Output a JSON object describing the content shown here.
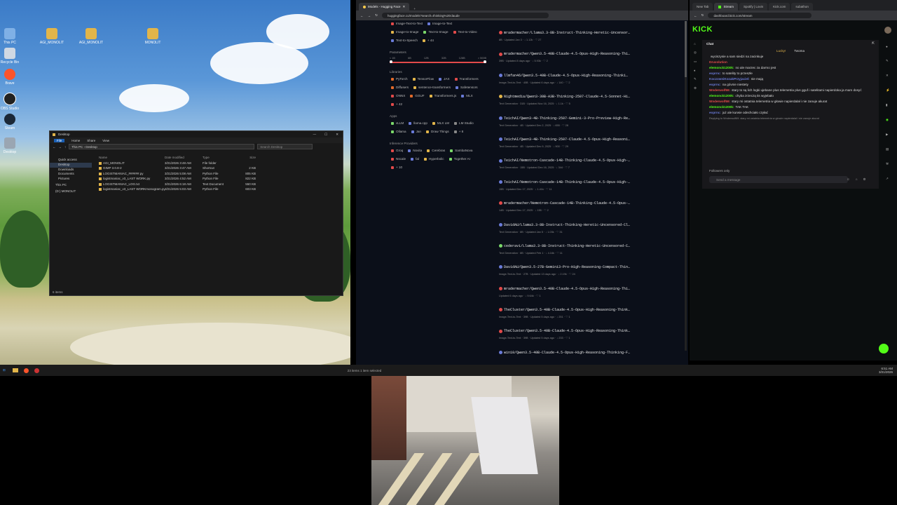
{
  "desktop": {
    "icons": [
      {
        "label": "This PC"
      },
      {
        "label": "AGI_MONOLIT"
      },
      {
        "label": "AGI_MONOLIT"
      },
      {
        "label": "MONOLIT"
      },
      {
        "label": "Recycle Bin"
      },
      {
        "label": "Brave"
      },
      {
        "label": "OBS Studio"
      },
      {
        "label": "Steam"
      },
      {
        "label": "Desktop"
      }
    ]
  },
  "explorer": {
    "title": "Desktop",
    "ribbon": [
      "File",
      "Home",
      "Share",
      "View"
    ],
    "breadcrumb": "This PC  ›  Desktop",
    "search_placeholder": "Search Desktop",
    "nav": [
      "Quick access",
      "Desktop",
      "Downloads",
      "Documents",
      "Pictures",
      "This PC",
      "(D:) MONOLIT"
    ],
    "columns": [
      "Name",
      "Date modified",
      "Type",
      "Size"
    ],
    "rows": [
      [
        "AGI_MONOLIT",
        "3/21/2026 3:48 AM",
        "File folder",
        ""
      ],
      [
        "GIMP 3.0.8-2",
        "3/21/2026 3:47 AM",
        "Shortcut",
        "2 KB"
      ],
      [
        "LOGISTMANIAC_######.py",
        "3/21/2026 5:08 AM",
        "Python File",
        "805 KB"
      ],
      [
        "logistmaniac_v3_LAST WORK.py",
        "3/21/2026 4:52 AM",
        "Python File",
        "822 KB"
      ],
      [
        "LOGISTMANIAC_LOG.txt",
        "3/21/2026 6:18 AM",
        "Text Document",
        "550 KB"
      ],
      [
        "logistmaniac_v3_LAST WORKmonogram.py",
        "3/21/2026 5:03 AM",
        "Python File",
        "603 KB"
      ]
    ],
    "status": "6 items"
  },
  "hf": {
    "tabs": [
      {
        "label": "Models - Hugging Face"
      }
    ],
    "url": "huggingface.co/models?search=thinking%20claude",
    "tasks": [
      "Image-Text-to-Text",
      "Image-to-Text",
      "Image-to-Image",
      "Text-to-Image",
      "Text-to-Video",
      "Text-to-Speech",
      "+ 44"
    ],
    "parameters_label": "Parameters",
    "param_ticks": [
      "< 1B",
      "6B",
      "12B",
      "32B",
      "128B",
      "> 500B"
    ],
    "libraries_label": "Libraries",
    "libraries": [
      "PyTorch",
      "TensorFlow",
      "JAX",
      "Transformers",
      "Diffusers",
      "sentence-transformers",
      "Safetensors",
      "ONNX",
      "GGUF",
      "Transformers.js",
      "MLX",
      "+ 42"
    ],
    "apps_label": "Apps",
    "apps": [
      "vLLM",
      "llama.cpp",
      "MLX LM",
      "LM Studio",
      "Ollama",
      "Jan",
      "Draw Things",
      "+ 8"
    ],
    "providers_label": "Inference Providers",
    "providers": [
      "Groq",
      "Novita",
      "Cerebras",
      "SambaNova",
      "Nscale",
      "fal",
      "Hyperbolic",
      "Together AI",
      "+ 10"
    ],
    "models": [
      {
        "name": "mradermacher/Llama3.3-8B-Instruct-Thinking-Heretic-Uncensor…",
        "meta": "8B · Updated Jan 3 · ↓ 1.12k · ♡ 27",
        "color": "#e24a4a"
      },
      {
        "name": "mradermacher/Qwen3.5-40B-Claude-4.5-Opus-High-Reasoning-Thi…",
        "meta": "39B · Updated 8 days ago · ↓ 5.93k · ♡ 2",
        "color": "#e24a4a"
      },
      {
        "name": "llmfan46/Qwen3.5-40B-Claude-4.5-Opus-High-Reasoning-Thinki…",
        "meta": "Image-Text-to-Text · 40B · Updated 6 days ago · ↓ 140 · ♡ 2",
        "color": "#6a7bd8"
      },
      {
        "name": "Nightmedia/Qwen3-30B-A3B-Thinking-2507-Claude-4.5-Sonnet-Hi…",
        "meta": "Text Generation · 31B · Updated Nov 16, 2025 · ↓ 1.1k · ♡ 5",
        "color": "#e2b54a"
      },
      {
        "name": "TeichAI/Qwen3-4B-Thinking-2507-Gemini-3-Pro-Preview-High-Re…",
        "meta": "Text Generation · 4B · Updated Dec 2, 2025 · ↓ 655 · ♡ 28",
        "color": "#6a7bd8"
      },
      {
        "name": "TeichAI/Qwen3-4B-Thinking-2507-Claude-4.5-Opus-High-Reasoni…",
        "meta": "Text Generation · 4B · Updated Dec 9, 2025 · ↓ 900 · ♡ 29",
        "color": "#6a7bd8"
      },
      {
        "name": "TeichAI/Nemotron-Cascade-14B-Thinking-Claude-4.5-Opus-High-…",
        "meta": "Text Generation · 15B · Updated Dec 16, 2025 · ↓ 344 · ♡ 7",
        "color": "#6a7bd8"
      },
      {
        "name": "TeichAI/Nemotron-Cascade-14B-Thinking-Claude-4.5-Opus-High-…",
        "meta": "15B · Updated Dec 17, 2025 · ↓ 1.41k · ♡ 11",
        "color": "#6a7bd8"
      },
      {
        "name": "mradermacher/Nemotron-Cascade-14B-Thinking-Claude-4.5-Opus-…",
        "meta": "14B · Updated Dec 17, 2025 · ↓ 155 · ♡ 2",
        "color": "#e24a4a"
      },
      {
        "name": "DavidAU/Llama3.3-8B-Instruct-Thinking-Heretic-Uncensored-Cl…",
        "meta": "Text Generation · 8B · Updated Jan 5 · ↓ 1.03k · ♡ 31",
        "color": "#6a7bd8"
      },
      {
        "name": "cederavi/Llama3.3-8B-Instruct-Thinking-Heretic-Uncensored-C…",
        "meta": "Text Generation · 8B · Updated Feb 1 · ↓ 4.16k · ♡ 11",
        "color": "#7bd86a"
      },
      {
        "name": "DavidAU/Qwen3.5-27B-Gemini3-Pro-High-Reasoning-Compact-Thin…",
        "meta": "Image-Text-to-Text · 27B · Updated 13 days ago · ↓ 2.19k · ♡ 24",
        "color": "#6a7bd8"
      },
      {
        "name": "mradermacher/Qwen3.5-40B-Claude-4.5-Opus-High-Reasoning-Thi…",
        "meta": "Updated 6 days ago · ↓ 9.64k · ♡ 1",
        "color": "#e24a4a"
      },
      {
        "name": "TheCluster/Qwen3.5-40B-Claude-4.5-Opus-High-Reasoning-Think…",
        "meta": "Image-Text-to-Text · 39B · Updated 5 days ago · ↓ 251 · ♡ 1",
        "color": "#e24a4a"
      },
      {
        "name": "TheCluster/Qwen3.5-40B-Claude-4.5-Opus-High-Reasoning-Think…",
        "meta": "Image-Text-to-Text · 39B · Updated 5 days ago · ↓ 233 · ♡ 1",
        "color": "#e24a4a"
      },
      {
        "name": "win10/Qwen3.5-40B-Claude-4.5-Opus-High-Reasoning-Thinking-F…",
        "meta": "",
        "color": "#6a7bd8"
      }
    ]
  },
  "kick": {
    "tabs": [
      "New Tab",
      "Stream",
      "Spotify | Lovin",
      "Kick.com",
      "subathon"
    ],
    "url": "dashboard.kick.com/stream",
    "logo": "KICK",
    "chat_title": "Chat",
    "pinned": [
      "Lucky!",
      "Twoma"
    ],
    "messages": [
      {
        "user": "",
        "text": "wyciszysie a sam siedzi na zacinkuje",
        "color": "#ffffff"
      },
      {
        "user": "Druvolution",
        "text": "",
        "color": "#e24a4a"
      },
      {
        "user": "elemonck1200k:",
        "text": "no ale marzec za darmo jest",
        "color": "#53fc18"
      },
      {
        "user": "eoprnc:",
        "text": "to satelity to przeszłe",
        "color": "#6a7bd8"
      },
      {
        "user": "KoczowniKozakPrzyjaciel:",
        "text": "nie mają",
        "color": "#6a7bd8"
      },
      {
        "user": "eoprnc:",
        "text": "na góvnie niestety",
        "color": "#6a7bd8"
      },
      {
        "user": "Wnderwolf69:",
        "text": "stary to są lich logki ujebane plus telemetria plus gguf i satelitami napierdoka ja mam dosyć",
        "color": "#e24a4a"
      },
      {
        "user": "elemonck1200k:",
        "text": "chyba zrzeczą tis wyjebało",
        "color": "#53fc18"
      },
      {
        "user": "Wnderwolf69:",
        "text": "stary mi ostatnia telemetria w głowie napierdalał i nie zanuje akurat",
        "color": "#e24a4a"
      },
      {
        "user": "elemonck1200k:",
        "text": "TAK TAK",
        "color": "#53fc18"
      },
      {
        "user": "eoprnc:",
        "text": "już ale kurwie odechciało czyłać",
        "color": "#6a7bd8"
      }
    ],
    "reply_hint": "Replying to Wnderwolf69: stary mi ostatnia telemetria w głowie napierdalał i nie zanuje akurat",
    "followers_only": "Followers only",
    "send_placeholder": "Send a message"
  },
  "taskbar": {
    "explorer_status": "6 items",
    "hf_status": "23 items   1 item selected",
    "time": "6:51 AM",
    "date": "3/21/2026"
  },
  "colors": {
    "kick_green": "#53fc18",
    "hf_bg": "#0b0f19",
    "explorer_bg": "#191919"
  }
}
